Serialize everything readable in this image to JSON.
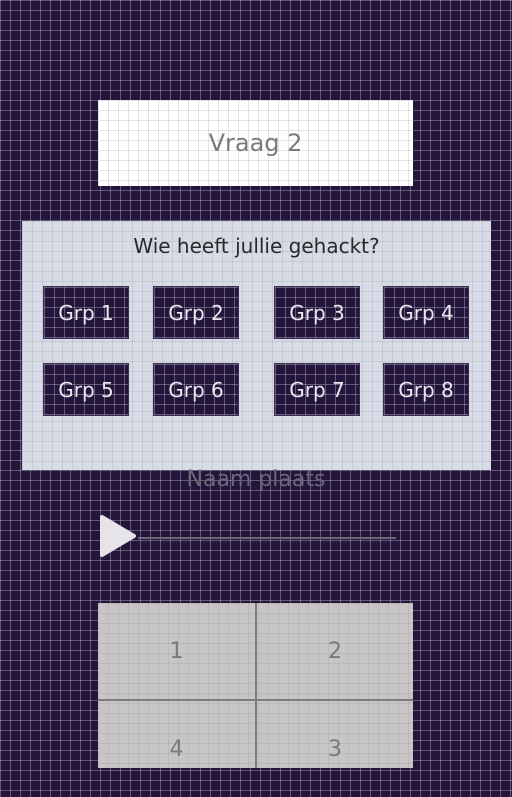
{
  "question": {
    "title": "Vraag 2"
  },
  "panel": {
    "prompt": "Wie heeft jullie gehackt?",
    "groups": [
      "Grp 1",
      "Grp 2",
      "Grp 3",
      "Grp 4",
      "Grp 5",
      "Grp 6",
      "Grp 7",
      "Grp 8"
    ]
  },
  "audio": {
    "place_label": "Naam plaats"
  },
  "keypad": {
    "keys": [
      "1",
      "2",
      "4",
      "3"
    ]
  },
  "colors": {
    "background": "#24163a",
    "panel": "#d6dbe5",
    "question_box": "#ffffff",
    "keypad": "#c8c5c6"
  },
  "icons": {
    "play": "play-icon"
  }
}
